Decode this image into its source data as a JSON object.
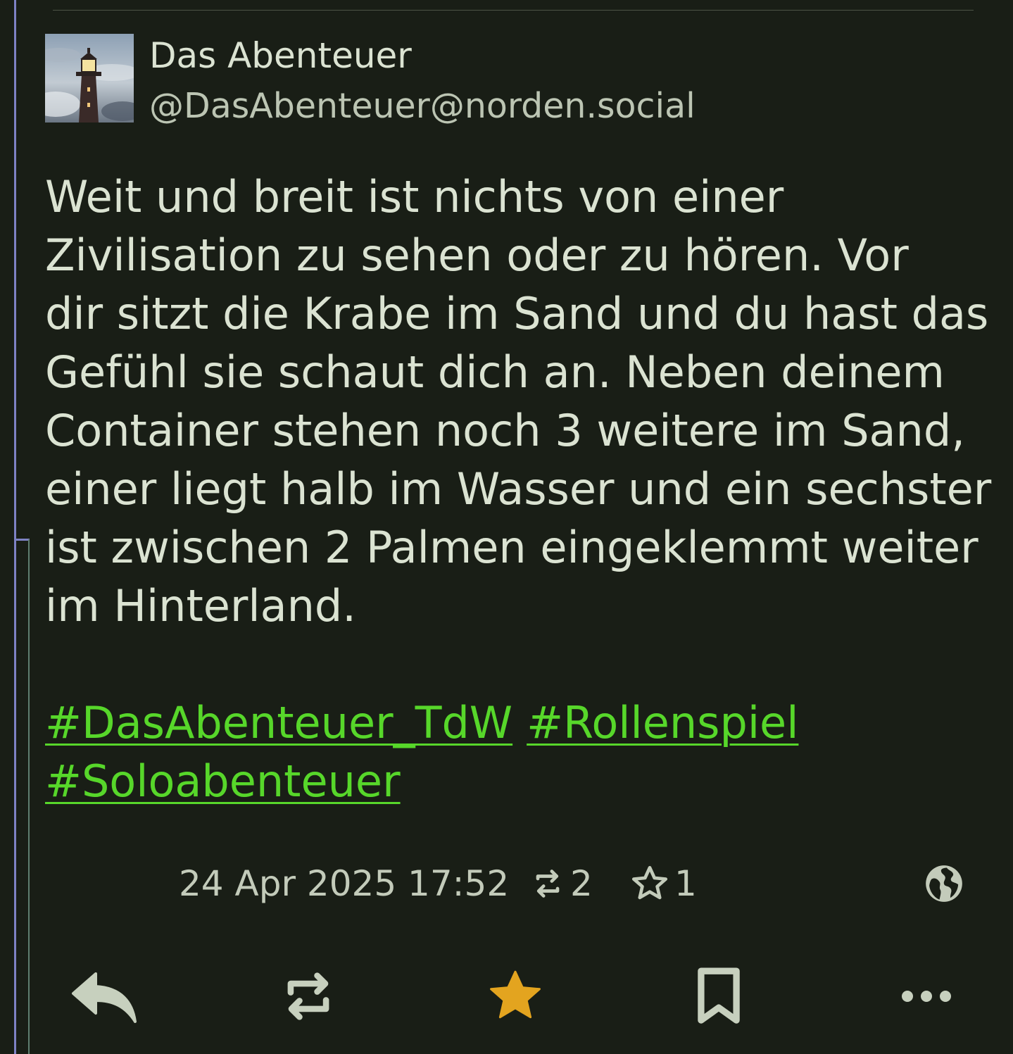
{
  "post": {
    "author": {
      "display_name": "Das Abenteuer",
      "handle": "@DasAbenteuer@norden.social"
    },
    "content_lines": [
      "Weit und breit ist nichts von einer",
      "Zivilisation zu sehen oder zu hören. Vor",
      "dir sitzt die Krabe im Sand und du hast das",
      "Gefühl sie schaut dich an. Neben deinem",
      "Container stehen noch 3 weitere im Sand,",
      "einer liegt halb im Wasser und ein sechster",
      "ist zwischen 2 Palmen eingeklemmt weiter",
      "im Hinterland."
    ],
    "hashtags": [
      "#DasAbenteuer_TdW",
      "#Rollenspiel",
      "#Soloabenteuer"
    ],
    "timestamp": "24 Apr 2025 17:52",
    "boost_count": "2",
    "favourite_count": "1",
    "visibility_icon": "globe-icon",
    "favourited": true
  },
  "actions": [
    {
      "name": "reply",
      "icon": "reply-icon"
    },
    {
      "name": "boost",
      "icon": "repeat-icon"
    },
    {
      "name": "favourite",
      "icon": "star-icon"
    },
    {
      "name": "bookmark",
      "icon": "bookmark-icon"
    },
    {
      "name": "more",
      "icon": "more-icon"
    }
  ],
  "colors": {
    "background": "#191e16",
    "text": "#dbe3d2",
    "hashtag": "#57d72a",
    "favourite_active": "#e3a41f",
    "thread_line": "#7e82c4"
  }
}
